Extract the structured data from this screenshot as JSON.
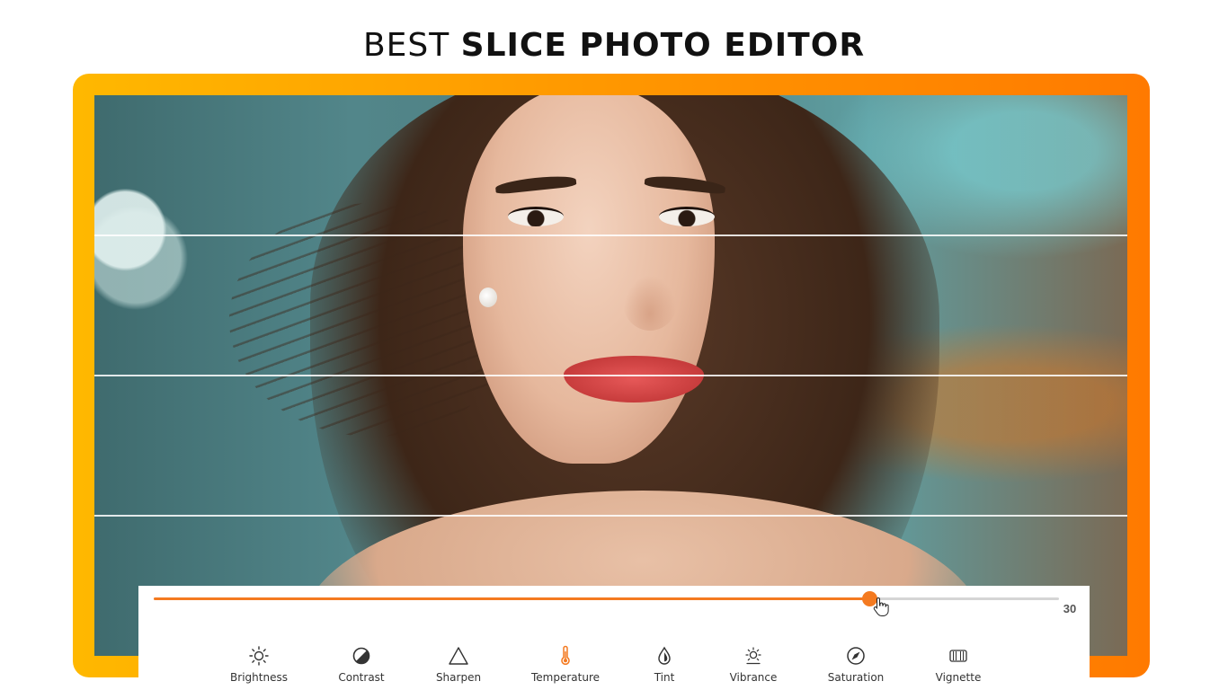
{
  "headline": {
    "light": "BEST ",
    "bold": "SLICE PHOTO EDITOR"
  },
  "colors": {
    "accent": "#f47a20",
    "frame_gradient_start": "#ffb800",
    "frame_gradient_end": "#ff7a00",
    "track": "#d5d5d5"
  },
  "slider": {
    "value_label": "30",
    "fill_fraction": 0.79
  },
  "tools": [
    {
      "label": "Brightness",
      "icon": "brightness-icon",
      "active": false
    },
    {
      "label": "Contrast",
      "icon": "contrast-icon",
      "active": false
    },
    {
      "label": "Sharpen",
      "icon": "sharpen-icon",
      "active": false
    },
    {
      "label": "Temperature",
      "icon": "thermometer-icon",
      "active": true
    },
    {
      "label": "Tint",
      "icon": "droplet-icon",
      "active": false
    },
    {
      "label": "Vibrance",
      "icon": "vibrance-icon",
      "active": false
    },
    {
      "label": "Saturation",
      "icon": "saturation-icon",
      "active": false
    },
    {
      "label": "Vignette",
      "icon": "vignette-icon",
      "active": false
    }
  ]
}
